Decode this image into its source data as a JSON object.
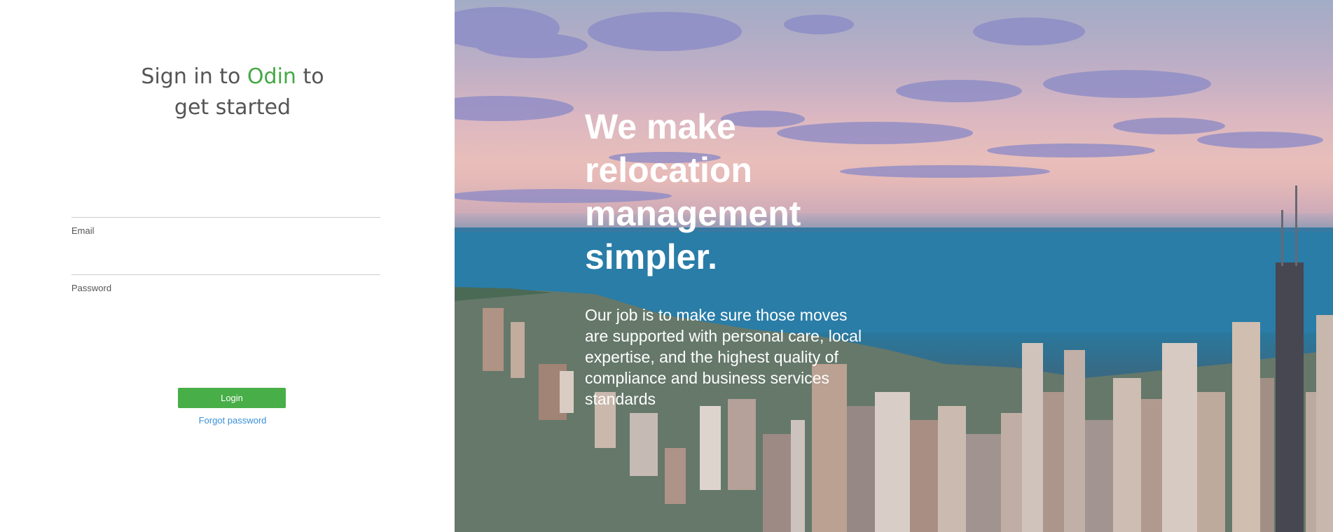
{
  "login": {
    "heading_prefix": "Sign in to ",
    "heading_brand": "Odin",
    "heading_suffix": " to",
    "heading_line2": "get started",
    "email_label": "Email",
    "email_value": "",
    "password_label": "Password",
    "password_value": "",
    "login_button": "Login",
    "forgot_link": "Forgot password"
  },
  "hero": {
    "tagline_lines": [
      "We make",
      "relocation",
      "management",
      "simpler."
    ],
    "description": "Our job is to make sure those moves are supported with personal care, local expertise, and the highest quality of compliance and business services standards"
  },
  "colors": {
    "brand_green": "#44a844",
    "button_green": "#48ae48",
    "link_blue": "#3a8fd6",
    "text_gray": "#555555"
  }
}
